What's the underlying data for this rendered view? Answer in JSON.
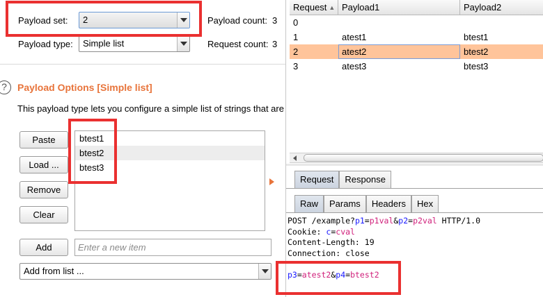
{
  "payload_positions": {
    "payload_set_label": "Payload set:",
    "payload_set_value": "2",
    "payload_count_label": "Payload count:",
    "payload_count_value": "3",
    "payload_type_label": "Payload type:",
    "payload_type_value": "Simple list",
    "request_count_label": "Request count:",
    "request_count_value": "3"
  },
  "payload_options": {
    "help_glyph": "?",
    "title": "Payload Options [Simple list]",
    "description": "This payload type lets you configure a simple list of strings that are",
    "buttons": {
      "paste": "Paste",
      "load": "Load ...",
      "remove": "Remove",
      "clear": "Clear",
      "add": "Add"
    },
    "items": [
      "btest1",
      "btest2",
      "btest3"
    ],
    "new_item_placeholder": "Enter a new item",
    "add_from_list": "Add from list ..."
  },
  "results_table": {
    "columns": [
      "Request",
      "Payload1",
      "Payload2"
    ],
    "sort_glyph": "▲",
    "rows": [
      {
        "request": "0",
        "payload1": "",
        "payload2": ""
      },
      {
        "request": "1",
        "payload1": "atest1",
        "payload2": "btest1"
      },
      {
        "request": "2",
        "payload1": "atest2",
        "payload2": "btest2"
      },
      {
        "request": "3",
        "payload1": "atest3",
        "payload2": "btest3"
      }
    ],
    "selected_request": "2"
  },
  "message_tabs": {
    "top": [
      "Request",
      "Response"
    ],
    "top_active": "Request",
    "sub": [
      "Raw",
      "Params",
      "Headers",
      "Hex"
    ],
    "sub_active": "Raw"
  },
  "raw_request": {
    "line1": {
      "prefix": "POST /example?",
      "p1_name": "p1",
      "eq1": "=",
      "p1_val": "p1val",
      "amp": "&",
      "p2_name": "p2",
      "eq2": "=",
      "p2_val": "p2val",
      "suffix": " HTTP/1.0"
    },
    "line2": {
      "prefix": "Cookie: ",
      "name": "c",
      "eq": "=",
      "val": "cval"
    },
    "line3": "Content-Length: 19",
    "line4": "Connection: close",
    "body": {
      "p3_name": "p3",
      "eq1": "=",
      "p3_val": "atest2",
      "amp": "&",
      "p4_name": "p4",
      "eq2": "=",
      "p4_val": "btest2"
    }
  },
  "colors": {
    "accent_orange": "#e8743b",
    "selected_row": "#ffc49a",
    "highlight_box": "#ea3030",
    "param_name": "#1818ff",
    "param_value": "#d0207b"
  }
}
